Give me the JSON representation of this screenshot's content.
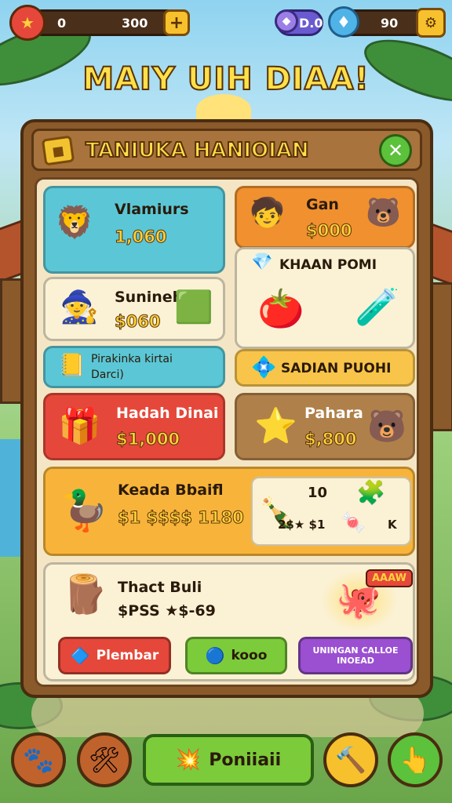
{
  "hud": {
    "left_currency": "0",
    "left_amount": "300",
    "gem_value": "D.0",
    "right_amount": "90",
    "plus": "+"
  },
  "title": "MAIY UIH DIAA!",
  "shop": {
    "header": "TANIUKA HANIOIAN",
    "close_icon": "✕",
    "cards": {
      "vlamiurs": {
        "name": "Vlamiurs",
        "price": "1,060"
      },
      "gan": {
        "name": "Gan",
        "price": "$000"
      },
      "khaan": {
        "name": "KHAAN POMI"
      },
      "sunineh": {
        "name": "Sunineh",
        "price": "$060"
      },
      "pirakinka": {
        "line1": "Pirakinka kirtai",
        "line2": "Darci)"
      },
      "saidan": {
        "name": "SADIAN PUOHI"
      },
      "hadah": {
        "name": "Hadah Dinai",
        "price": "$1,000"
      },
      "pahara": {
        "name": "Pahara",
        "price": "$,800"
      },
      "keada": {
        "name": "Keada Bbaifl",
        "price": "$1 $$$$ 1180",
        "side_top": "10",
        "side_bottom_a": "2$★ $1",
        "side_bottom_b": "K"
      },
      "thact": {
        "name": "Thact Buli",
        "price": "$PSS ★$-69",
        "badge": "AAAW"
      }
    },
    "buttons": {
      "plembar": "Plembar",
      "kooo": "kooo",
      "purple_line1": "UNINGAN CALLOE",
      "purple_line2": "INOEAD"
    }
  },
  "bottom_nav": {
    "main_button": "Poniiaii"
  },
  "colors": {
    "teal": "#5bc7d6",
    "orange": "#f0902f",
    "cream": "#fbf2d6",
    "red": "#e5483a",
    "brown": "#b0804a",
    "gold": "#f8b43a",
    "green": "#7ccb3a",
    "purple": "#9b4fd1"
  }
}
